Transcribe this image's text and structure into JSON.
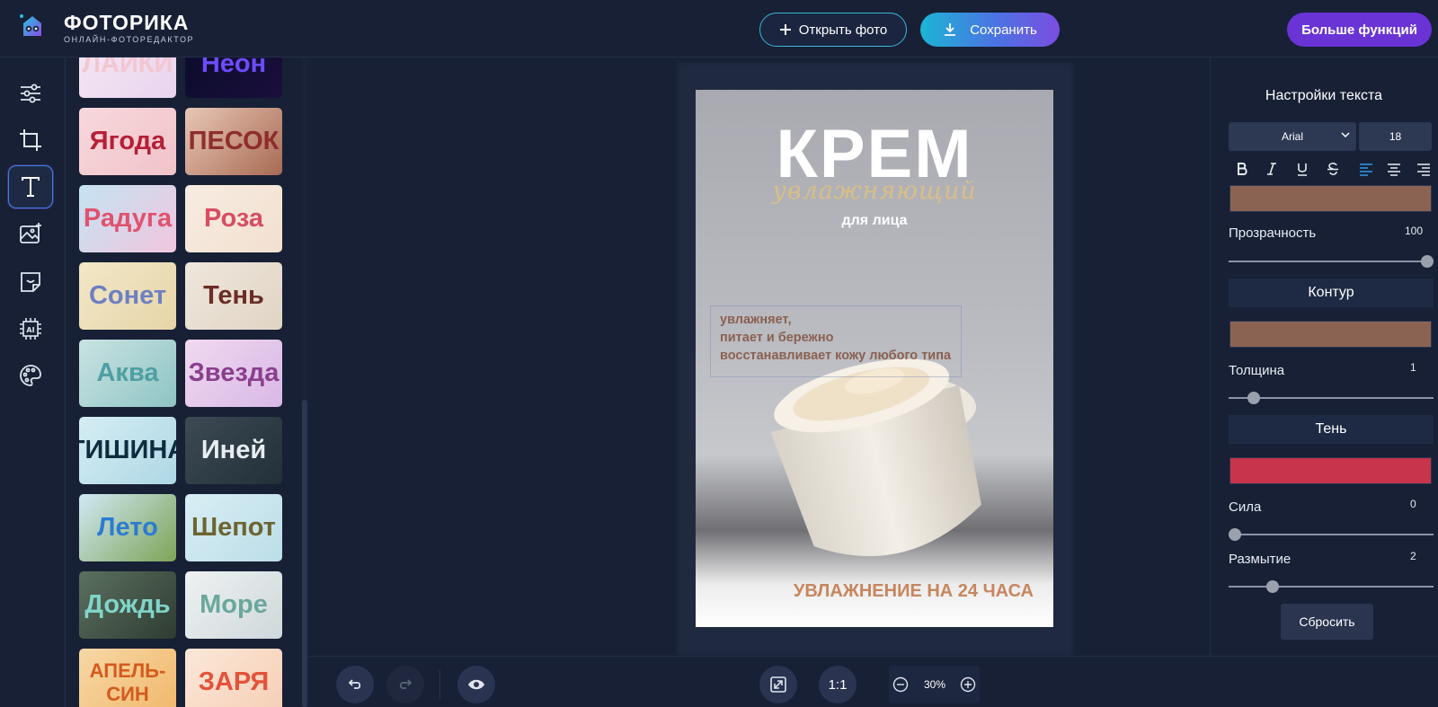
{
  "header": {
    "brand_title": "ФОТОРИКА",
    "brand_subtitle": "ОНЛАЙН-ФОТОРЕДАКТОР",
    "open_label": "Открыть фото",
    "save_label": "Сохранить",
    "more_label": "Больше функций"
  },
  "tools": [
    {
      "name": "adjust-icon"
    },
    {
      "name": "crop-icon"
    },
    {
      "name": "text-icon",
      "active": true
    },
    {
      "name": "image-add-icon"
    },
    {
      "name": "sticker-icon"
    },
    {
      "name": "ai-chip-icon"
    },
    {
      "name": "palette-icon"
    }
  ],
  "presets": [
    {
      "label": "ЛАЙКИ",
      "colors": [
        "#f6e7f2",
        "#e8d4ef"
      ],
      "fg": "#f4c6d0"
    },
    {
      "label": "Неон",
      "colors": [
        "#0a0b2a",
        "#1a0f3c"
      ],
      "fg": "#6e4bff"
    },
    {
      "label": "Ягода",
      "colors": [
        "#f7d8dc",
        "#f1c3c9"
      ],
      "fg": "#b51f37"
    },
    {
      "label": "ПЕСОК",
      "colors": [
        "#e8c7b6",
        "#a86a52"
      ],
      "fg": "#8e2d2d"
    },
    {
      "label": "Радуга",
      "colors": [
        "#c4e3f2",
        "#f1c6de"
      ],
      "fg": "#e0526f"
    },
    {
      "label": "Роза",
      "colors": [
        "#f7ece1",
        "#f2e0d0"
      ],
      "fg": "#d74d63"
    },
    {
      "label": "Сонет",
      "colors": [
        "#f2e7c7",
        "#e6d5a8"
      ],
      "fg": "#6e7fc2"
    },
    {
      "label": "Тень",
      "colors": [
        "#efe7dc",
        "#e0d4c4"
      ],
      "fg": "#6b2d25"
    },
    {
      "label": "Аква",
      "colors": [
        "#c9e3e2",
        "#8fc4c4"
      ],
      "fg": "#4f9fa3"
    },
    {
      "label": "Звезда",
      "colors": [
        "#f1d9f0",
        "#d8b8e6"
      ],
      "fg": "#8a3e8e"
    },
    {
      "label": "ТИШИНА",
      "colors": [
        "#d5edf3",
        "#aed7e5"
      ],
      "fg": "#0e2c3e"
    },
    {
      "label": "Иней",
      "colors": [
        "#3d4a54",
        "#22303a"
      ],
      "fg": "#e8eef0"
    },
    {
      "label": "Лето",
      "colors": [
        "#d0e8f4",
        "#7da457"
      ],
      "fg": "#2b7bd2"
    },
    {
      "label": "Шепот",
      "colors": [
        "#d8eef4",
        "#bcdde8"
      ],
      "fg": "#6d6430"
    },
    {
      "label": "Дождь",
      "colors": [
        "#5b7060",
        "#2f3c31"
      ],
      "fg": "#7fd6c9"
    },
    {
      "label": "Море",
      "colors": [
        "#eef1f2",
        "#cfd8db"
      ],
      "fg": "#6aa79d"
    },
    {
      "label": "АПЕЛЬ-СИН",
      "colors": [
        "#f7d7a6",
        "#f0b86b"
      ],
      "fg": "#d45a1d"
    },
    {
      "label": "ЗАРЯ",
      "colors": [
        "#fbe7d8",
        "#f6cfb5"
      ],
      "fg": "#e3523a"
    }
  ],
  "poster": {
    "title": "КРЕМ",
    "subtitle": "увлажняющий",
    "face": "для лица",
    "lines": [
      "увлажняет,",
      "питает и бережно",
      "восстанавливает кожу любого типа"
    ],
    "bottom": "УВЛАЖНЕНИЕ НА 24 ЧАСА"
  },
  "text_settings": {
    "title": "Настройки текста",
    "font": "Arial",
    "size": "18",
    "text_color": "#8b6352",
    "opacity_label": "Прозрачность",
    "opacity_value": "100",
    "outline_label": "Контур",
    "outline_color": "#8b6352",
    "thickness_label": "Толщина",
    "thickness_value": "1",
    "shadow_label": "Тень",
    "shadow_color": "#c7344b",
    "strength_label": "Сила",
    "strength_value": "0",
    "blur_label": "Размытие",
    "blur_value": "2",
    "reset_label": "Сбросить"
  },
  "bottombar": {
    "ratio_label": "1:1",
    "zoom_value": "30%"
  }
}
